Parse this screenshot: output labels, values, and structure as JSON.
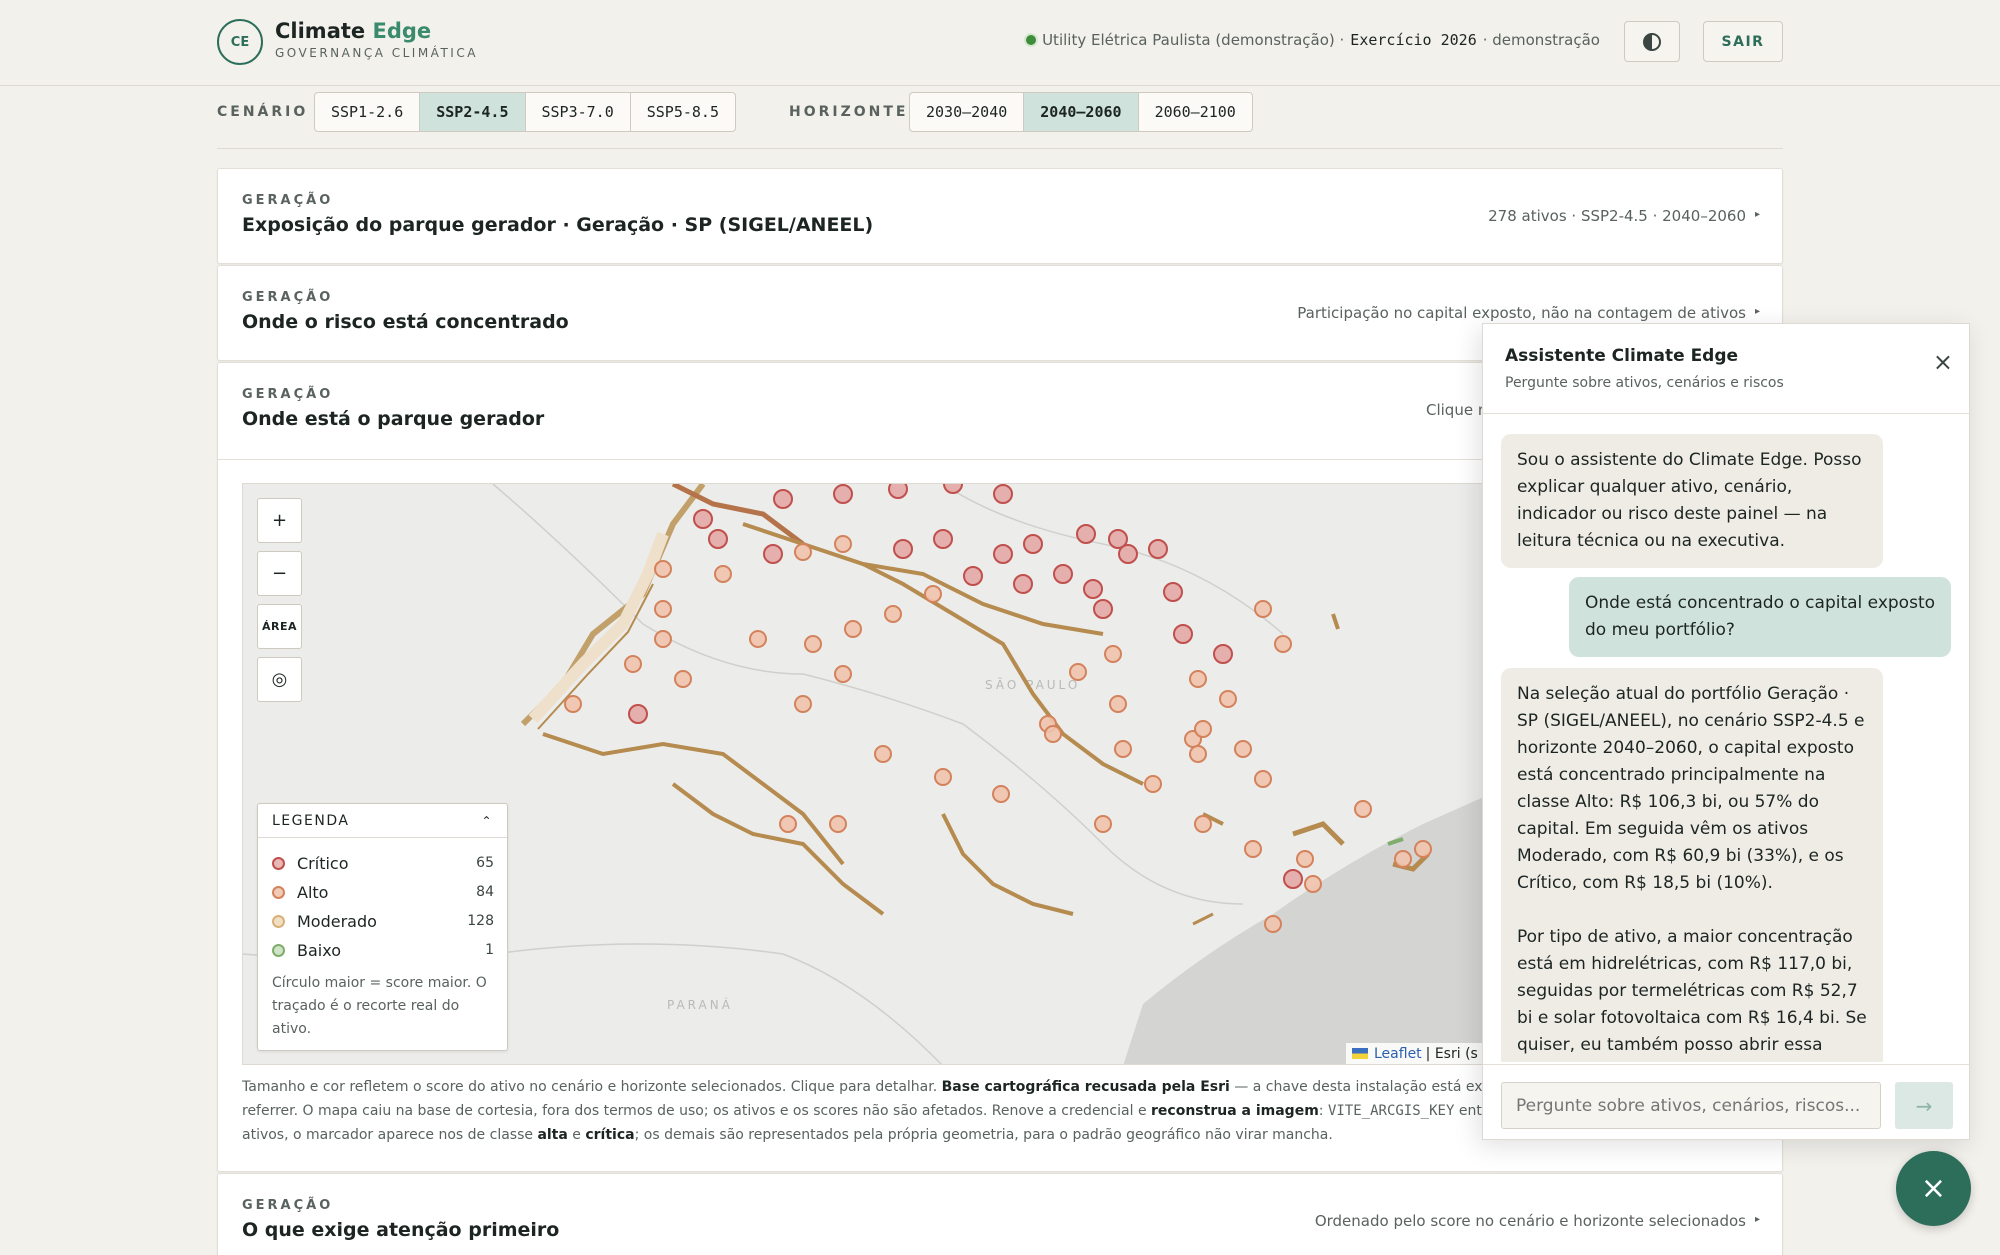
{
  "header": {
    "logo_initials": "CE",
    "brand_main": "Climate",
    "brand_accent": "Edge",
    "brand_sub": "GOVERNANÇA CLIMÁTICA",
    "org": "Utility Elétrica Paulista (demonstração) ·",
    "exercise": "Exercício 2026",
    "mode": "· demonstração",
    "logout": "SAIR"
  },
  "controls": {
    "scenario_label": "CENÁRIO",
    "scenarios": [
      "SSP1-2.6",
      "SSP2-4.5",
      "SSP3-7.0",
      "SSP5-8.5"
    ],
    "scenario_selected": "SSP2-4.5",
    "horizon_label": "HORIZONTE",
    "horizons": [
      "2030–2040",
      "2040–2060",
      "2060–2100"
    ],
    "horizon_selected": "2040–2060"
  },
  "cards": [
    {
      "eyebrow": "GERAÇÃO",
      "title": "Exposição do parque gerador · Geração · SP (SIGEL/ANEEL)",
      "meta": "278 ativos · SSP2-4.5 · 2040–2060"
    },
    {
      "eyebrow": "GERAÇÃO",
      "title": "Onde o risco está concentrado",
      "meta": "Participação no capital exposto, não na contagem de ativos"
    },
    {
      "eyebrow": "GERAÇÃO",
      "title": "Onde está o parque gerador",
      "meta": "Clique n"
    },
    {
      "eyebrow": "GERAÇÃO",
      "title": "O que exige atenção primeiro",
      "meta": "Ordenado pelo score no cenário e horizonte selecionados"
    }
  ],
  "map": {
    "controls": {
      "zoom_in": "+",
      "zoom_out": "−",
      "area": "ÁREA",
      "locate": "◎"
    },
    "region_labels": [
      "SÃO PAULO",
      "PARANÁ"
    ],
    "legend": {
      "title": "LEGENDA",
      "items": [
        {
          "label": "Crítico",
          "count": "65",
          "color": "#c0504d"
        },
        {
          "label": "Alto",
          "count": "84",
          "color": "#d4825c"
        },
        {
          "label": "Moderado",
          "count": "128",
          "color": "#d9b07a"
        },
        {
          "label": "Baixo",
          "count": "1",
          "color": "#7fae6c"
        }
      ],
      "note": "Círculo maior = score maior. O traçado é o recorte real do ativo."
    },
    "attribution_leaflet": "Leaflet",
    "attribution_rest": "| Esri (s",
    "footer": {
      "l1a": "Tamanho e cor refletem o score do ativo no cenário e horizonte selecionados. Clique para detalhar. ",
      "l1b": "Base cartográfica recusada pela Esri",
      "l1c": " — a chave desta instalação está expirada",
      "l2a": "referrer. O mapa caiu na base de cortesia, fora dos termos de uso; os ativos e os scores não são afetados. Renove a credencial e ",
      "l2b": "reconstrua a imagem",
      "l2c": ": ",
      "l2d": "VITE_ARCGIS_KEY",
      "l2e": " entra n",
      "l3a": "ativos, o marcador aparece nos de classe ",
      "l3b": "alta",
      "l3c": " e ",
      "l3d": "crítica",
      "l3e": "; os demais são representados pela própria geometria, para o padrão geográfico não virar mancha."
    }
  },
  "assistant": {
    "title": "Assistente Climate Edge",
    "subtitle": "Pergunte sobre ativos, cenários e riscos",
    "close": "×",
    "messages": [
      {
        "role": "bot",
        "text": "Sou o assistente do Climate Edge. Posso explicar qualquer ativo, cenário, indicador ou risco deste painel — na leitura técnica ou na executiva."
      },
      {
        "role": "user",
        "text": "Onde está concentrado o capital exposto do meu portfólio?"
      },
      {
        "role": "bot",
        "p1": "Na seleção atual do portfólio Geração · SP (SIGEL/ANEEL), no cenário SSP2-4.5 e horizonte 2040–2060, o capital exposto está concentrado principalmente na classe Alto: R$ 106,3 bi, ou 57% do capital. Em seguida vêm os ativos Moderado, com R$ 60,9 bi (33%), e os Crítico, com R$ 18,5 bi (10%).",
        "p2": "Por tipo de ativo, a maior concentração está em hidrelétricas, com R$ 117,0 bi, seguidas por termelétricas com R$ 52,7 bi e solar fotovoltaica com R$ 16,4 bi. Se quiser, eu também posso abrir essa concentração sob outro recorte."
      }
    ],
    "input_placeholder": "Pergunte sobre ativos, cenários, riscos...",
    "send": "→"
  },
  "fab": "×"
}
